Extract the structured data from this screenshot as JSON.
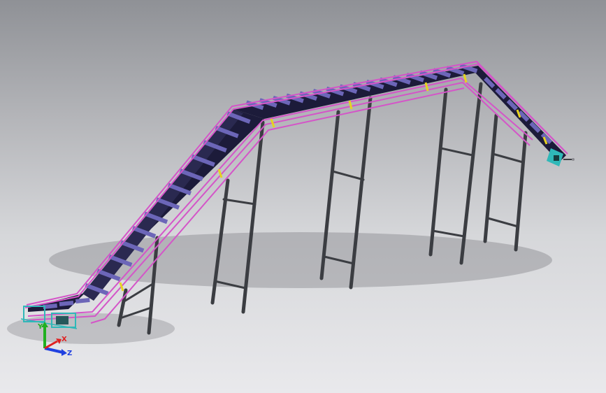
{
  "viewport": {
    "background_top": "#8f9196",
    "background_bottom": "#e9e9ec"
  },
  "model": {
    "frame_color": "#d455c8",
    "leg_color": "#3b3d42",
    "belt_color": "#1c1b3a",
    "cleat_color": "#6c66b8",
    "bracket_color": "#e6d320",
    "motor_color": "#2fb8b8"
  },
  "triad": {
    "x_label": "X",
    "y_label": "Y",
    "z_label": "Z",
    "x_color": "#e02020",
    "y_color": "#20b020",
    "z_color": "#2040e0"
  }
}
